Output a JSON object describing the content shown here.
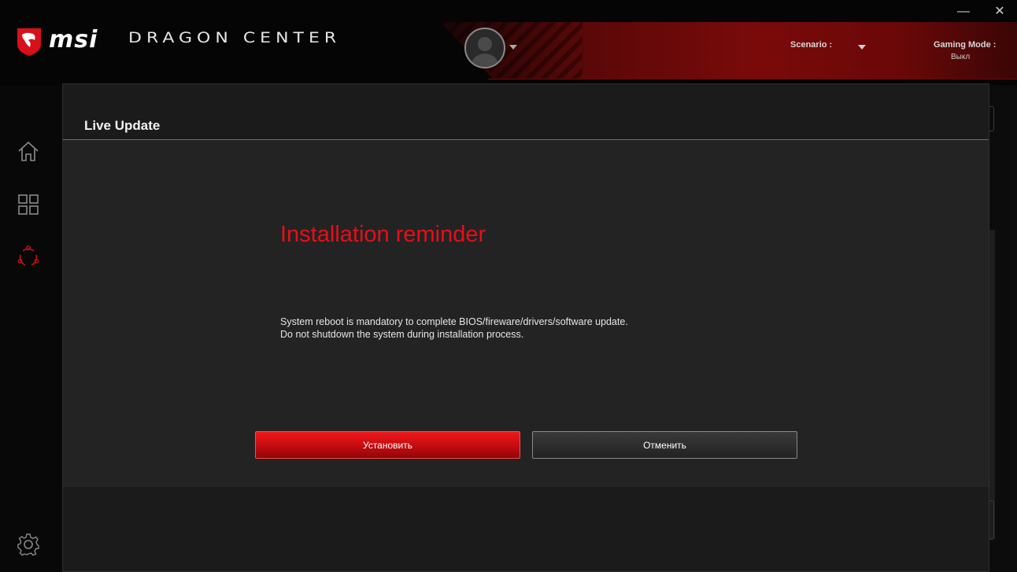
{
  "app": {
    "brand": "msi",
    "title": "DRAGON CENTER"
  },
  "window_controls": {
    "minimize": "—",
    "close": "✕"
  },
  "header": {
    "avatar_icon": "user-avatar-icon",
    "scenario_label": "Scenario :",
    "gaming_mode_label": "Gaming Mode :",
    "gaming_mode_value": "Выкл"
  },
  "sidebar": {
    "items": [
      {
        "name": "home",
        "icon": "home-icon"
      },
      {
        "name": "apps",
        "icon": "grid-icon"
      },
      {
        "name": "live-update",
        "icon": "update-cycle-icon",
        "active": true
      },
      {
        "name": "settings",
        "icon": "gear-icon"
      }
    ]
  },
  "dialog": {
    "title": "Live Update",
    "heading": "Installation reminder",
    "message_line1": "System reboot is mandatory to complete BIOS/fireware/drivers/software update.",
    "message_line2": "Do not shutdown the system during installation process.",
    "install_button": "Установить",
    "cancel_button": "Отменить"
  },
  "colors": {
    "accent": "#e3101a",
    "background": "#0a0a0a",
    "dialog_body": "#232323"
  }
}
